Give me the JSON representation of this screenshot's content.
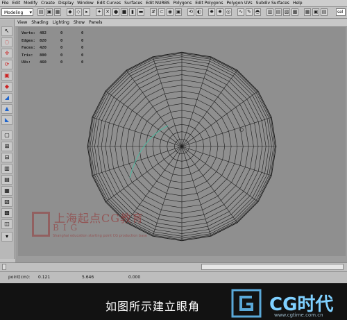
{
  "menu": [
    "File",
    "Edit",
    "Modify",
    "Create",
    "Display",
    "Window",
    "Edit Curves",
    "Surfaces",
    "Edit NURBS",
    "Polygons",
    "Edit Polygons",
    "Polygon UVs",
    "Subdiv Surfaces",
    "Help"
  ],
  "shelf": {
    "mode": "Modeling",
    "sel_label": "sel"
  },
  "panel_menu": [
    "View",
    "Shading",
    "Lighting",
    "Show",
    "Panels"
  ],
  "hud": [
    {
      "label": "Verts:",
      "v1": "402",
      "v2": "0",
      "v3": "0"
    },
    {
      "label": "Edges:",
      "v1": "820",
      "v2": "0",
      "v3": "0"
    },
    {
      "label": "Faces:",
      "v1": "420",
      "v2": "0",
      "v3": "0"
    },
    {
      "label": "Tris:",
      "v1": "800",
      "v2": "0",
      "v3": "0"
    },
    {
      "label": "UVs:",
      "v1": "460",
      "v2": "0",
      "v3": "0"
    }
  ],
  "watermark": {
    "cn": "上海起点CG教育",
    "sub": "BIG",
    "en": "Shanghai education starting point CG production base"
  },
  "status": {
    "label": "point(cm):",
    "x": "0.121",
    "y": "5.646",
    "z": "0.000"
  },
  "caption": "如图所示建立眼角",
  "brand": {
    "name": "CG时代",
    "url": "www.cgtime.com.cn"
  },
  "colors": {
    "viewport_bg": "#8f8f8f",
    "wire": "#1a1a1a",
    "curve": "#4fb8a0",
    "brand": "#7fd0ff"
  }
}
